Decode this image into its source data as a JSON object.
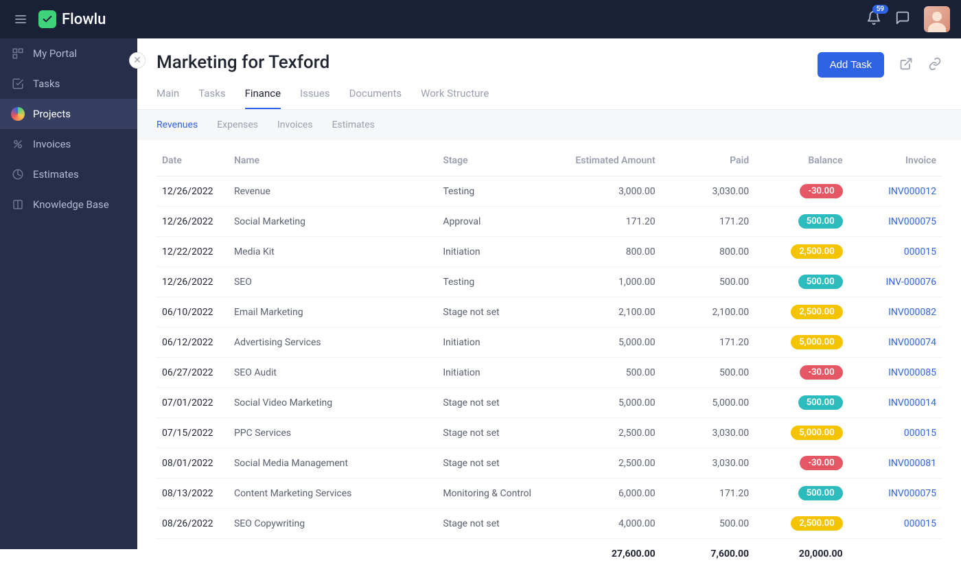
{
  "brand": "Flowlu",
  "notification_count": "59",
  "sidebar": {
    "items": [
      {
        "label": "My Portal"
      },
      {
        "label": "Tasks"
      },
      {
        "label": "Projects"
      },
      {
        "label": "Invoices"
      },
      {
        "label": "Estimates"
      },
      {
        "label": "Knowledge Base"
      }
    ]
  },
  "page": {
    "title": "Marketing for Texford",
    "add_task": "Add Task"
  },
  "tabs": [
    {
      "label": "Main"
    },
    {
      "label": "Tasks"
    },
    {
      "label": "Finance"
    },
    {
      "label": "Issues"
    },
    {
      "label": "Documents"
    },
    {
      "label": "Work Structure"
    }
  ],
  "subtabs": [
    {
      "label": "Revenues"
    },
    {
      "label": "Expenses"
    },
    {
      "label": "Invoices"
    },
    {
      "label": "Estimates"
    }
  ],
  "columns": {
    "date": "Date",
    "name": "Name",
    "stage": "Stage",
    "est": "Estimated Amount",
    "paid": "Paid",
    "balance": "Balance",
    "invoice": "Invoice"
  },
  "rows": [
    {
      "date": "12/26/2022",
      "name": "Revenue",
      "stage": "Testing",
      "est": "3,000.00",
      "paid": "3,030.00",
      "balance": "-30.00",
      "bal_class": "neg",
      "invoice": "INV000012"
    },
    {
      "date": "12/26/2022",
      "name": "Social Marketing",
      "stage": "Approval",
      "est": "171.20",
      "paid": "171.20",
      "balance": "500.00",
      "bal_class": "pos",
      "invoice": "INV000075"
    },
    {
      "date": "12/22/2022",
      "name": "Media Kit",
      "stage": "Initiation",
      "est": "800.00",
      "paid": "800.00",
      "balance": "2,500.00",
      "bal_class": "warn",
      "invoice": "000015"
    },
    {
      "date": "12/26/2022",
      "name": "SEO",
      "stage": "Testing",
      "est": "1,000.00",
      "paid": "500.00",
      "balance": "500.00",
      "bal_class": "pos",
      "invoice": "INV-000076"
    },
    {
      "date": "06/10/2022",
      "name": "Email Marketing",
      "stage": "Stage not set",
      "est": "2,100.00",
      "paid": "2,100.00",
      "balance": "2,500.00",
      "bal_class": "warn",
      "invoice": "INV000082"
    },
    {
      "date": "06/12/2022",
      "name": "Advertising Services",
      "stage": "Initiation",
      "est": "5,000.00",
      "paid": "171.20",
      "balance": "5,000.00",
      "bal_class": "warn",
      "invoice": "INV000074"
    },
    {
      "date": "06/27/2022",
      "name": "SEO Audit",
      "stage": "Initiation",
      "est": "500.00",
      "paid": "500.00",
      "balance": "-30.00",
      "bal_class": "neg",
      "invoice": "INV000085"
    },
    {
      "date": "07/01/2022",
      "name": "Social Video Marketing",
      "stage": "Stage not set",
      "est": "5,000.00",
      "paid": "5,000.00",
      "balance": "500.00",
      "bal_class": "pos",
      "invoice": "INV000014"
    },
    {
      "date": "07/15/2022",
      "name": "PPC Services",
      "stage": "Stage not set",
      "est": "2,500.00",
      "paid": "3,030.00",
      "balance": "5,000.00",
      "bal_class": "warn",
      "invoice": "000015"
    },
    {
      "date": "08/01/2022",
      "name": "Social Media Management",
      "stage": "Stage not set",
      "est": "2,500.00",
      "paid": "3,030.00",
      "balance": "-30.00",
      "bal_class": "neg",
      "invoice": "INV000081"
    },
    {
      "date": "08/13/2022",
      "name": "Content Marketing Services",
      "stage": "Monitoring & Control",
      "est": "6,000.00",
      "paid": "171.20",
      "balance": "500.00",
      "bal_class": "pos",
      "invoice": "INV000075"
    },
    {
      "date": "08/26/2022",
      "name": "SEO Copywriting",
      "stage": "Stage not set",
      "est": "4,000.00",
      "paid": "500.00",
      "balance": "2,500.00",
      "bal_class": "warn",
      "invoice": "000015"
    }
  ],
  "totals": {
    "est": "27,600.00",
    "paid": "7,600.00",
    "balance": "20,000.00"
  }
}
